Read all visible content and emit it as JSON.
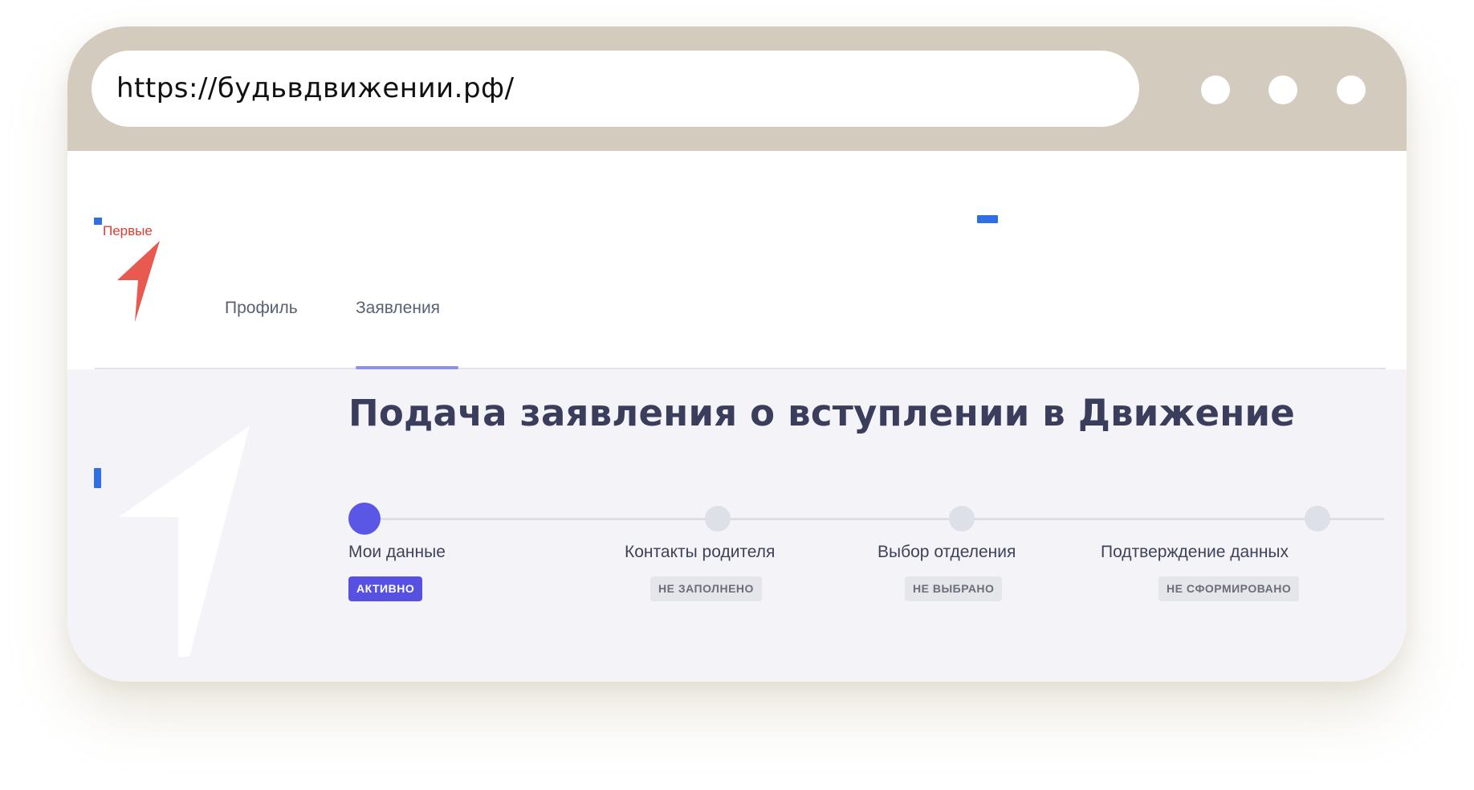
{
  "browser": {
    "url": "https://будьвдвижении.рф/"
  },
  "brand": {
    "text": "Первые",
    "accent_color": "#e63b32"
  },
  "nav": {
    "tabs": [
      {
        "label": "Профиль",
        "active": false
      },
      {
        "label": "Заявления",
        "active": true
      }
    ]
  },
  "main": {
    "title": "Подача заявления о вступлении в Движение",
    "steps": [
      {
        "label": "Мои данные",
        "status": "АКТИВНО",
        "active": true
      },
      {
        "label": "Контакты родителя",
        "status": "НЕ ЗАПОЛНЕНО",
        "active": false
      },
      {
        "label": "Выбор отделения",
        "status": "НЕ ВЫБРАНО",
        "active": false
      },
      {
        "label": "Подтверждение данных",
        "status": "НЕ СФОРМИРОВАНО",
        "active": false
      }
    ]
  },
  "colors": {
    "chrome": "#d2cbbe",
    "active_step": "#5a56e6",
    "title": "#3b3d5c"
  }
}
